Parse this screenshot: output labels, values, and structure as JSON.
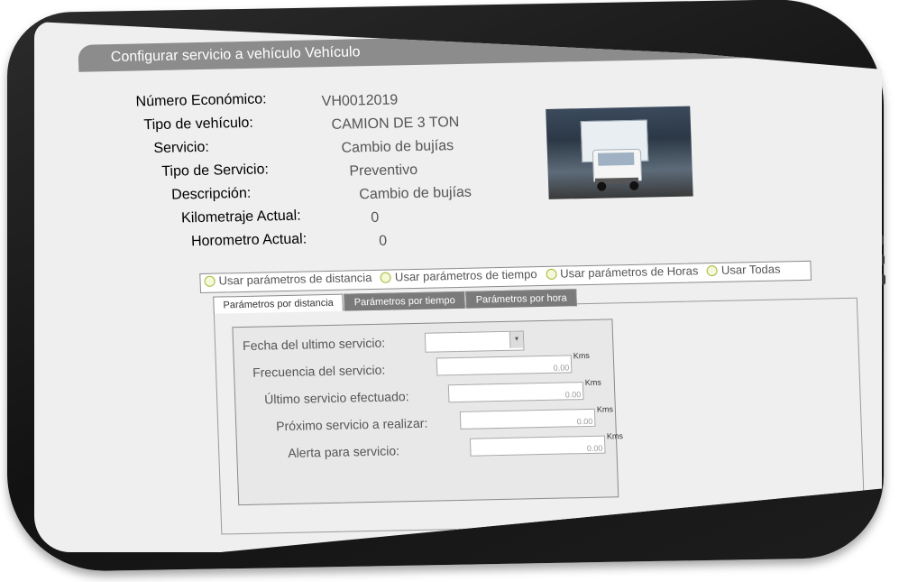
{
  "page": {
    "title": "Configurar servicio a vehículo Vehículo"
  },
  "vehicle": {
    "fields": [
      {
        "label": "Número Económico:",
        "value": "VH0012019"
      },
      {
        "label": "Tipo de vehículo:",
        "value": "CAMION DE 3 TON"
      },
      {
        "label": "Servicio:",
        "value": "Cambio de bujías"
      },
      {
        "label": "Tipo de Servicio:",
        "value": "Preventivo"
      },
      {
        "label": "Descripción:",
        "value": "Cambio de bujías"
      },
      {
        "label": "Kilometraje Actual:",
        "value": "0"
      },
      {
        "label": "Horometro Actual:",
        "value": "0"
      }
    ]
  },
  "options": {
    "items": [
      {
        "label": "Usar parámetros de distancia"
      },
      {
        "label": "Usar parámetros de tiempo"
      },
      {
        "label": "Usar parámetros de Horas"
      },
      {
        "label": "Usar Todas"
      }
    ]
  },
  "tabs": [
    {
      "label": "Parámetros por distancia",
      "active": true
    },
    {
      "label": "Parámetros por tiempo",
      "active": false
    },
    {
      "label": "Parámetros por hora",
      "active": false
    }
  ],
  "form": {
    "fecha_label": "Fecha del ultimo servicio:",
    "rows": [
      {
        "label": "Frecuencia del servicio:",
        "value": "0.00",
        "unit": "Kms"
      },
      {
        "label": "Último servicio efectuado:",
        "value": "0.00",
        "unit": "Kms"
      },
      {
        "label": "Próximo servicio a realizar:",
        "value": "0.00",
        "unit": "Kms"
      },
      {
        "label": "Alerta para servicio:",
        "value": "0.00",
        "unit": "Kms"
      }
    ]
  },
  "colors": {
    "title_bar": "#8c8c8c",
    "radio_accent": "#a8b83a",
    "tab_inactive": "#7a7a7a",
    "bezel": "#1a1a1a"
  },
  "icons": {
    "select_arrow": "chevron-down-icon",
    "radio": "radio-icon"
  }
}
